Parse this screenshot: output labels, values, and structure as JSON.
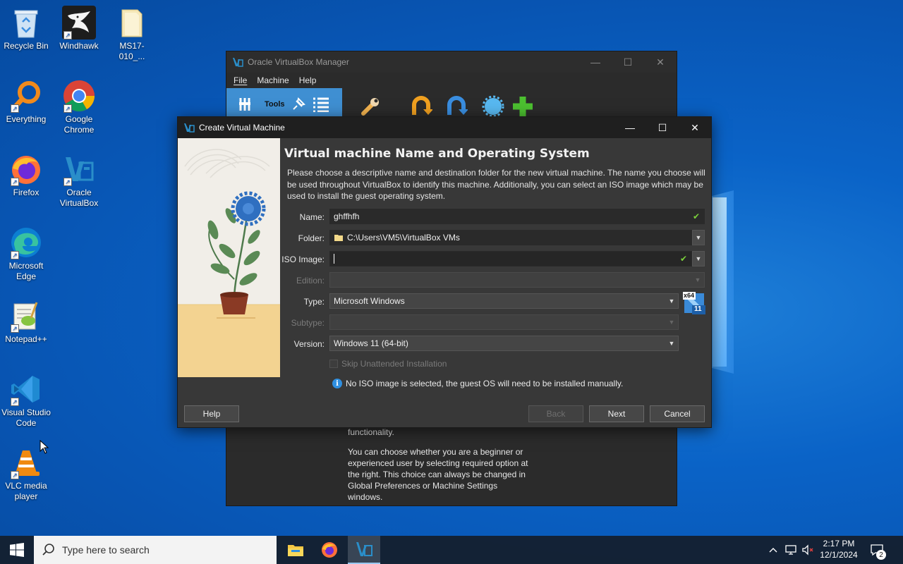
{
  "desktop": {
    "icons": [
      {
        "label": "Recycle Bin",
        "icon": "recycle-bin-icon"
      },
      {
        "label": "Windhawk",
        "icon": "windhawk-icon"
      },
      {
        "label": "MS17-010_...",
        "icon": "folder-icon"
      },
      {
        "label": "Everything",
        "icon": "everything-icon"
      },
      {
        "label": "Google Chrome",
        "icon": "chrome-icon"
      },
      {
        "label": "Firefox",
        "icon": "firefox-icon"
      },
      {
        "label": "Oracle VirtualBox",
        "icon": "virtualbox-icon"
      },
      {
        "label": "Microsoft Edge",
        "icon": "edge-icon"
      },
      {
        "label": "Notepad++",
        "icon": "notepadpp-icon"
      },
      {
        "label": "Visual Studio Code",
        "icon": "vscode-icon"
      },
      {
        "label": "VLC media player",
        "icon": "vlc-icon"
      }
    ]
  },
  "manager": {
    "title": "Oracle VirtualBox Manager",
    "menu": [
      "File",
      "Machine",
      "Help"
    ],
    "tools_label": "Tools",
    "welcome_text_1": "functionality.",
    "welcome_text_2": "You can choose whether you are a beginner or experienced user by selecting required option at the right. This choice can always be changed in Global Preferences or Machine Settings windows."
  },
  "dialog": {
    "title": "Create Virtual Machine",
    "heading": "Virtual machine Name and Operating System",
    "description": "Please choose a descriptive name and destination folder for the new virtual machine. The name you choose will be used throughout VirtualBox to identify this machine. Additionally, you can select an ISO image which may be used to install the guest operating system.",
    "labels": {
      "name": "Name:",
      "folder": "Folder:",
      "iso": "ISO Image:",
      "edition": "Edition:",
      "type": "Type:",
      "subtype": "Subtype:",
      "version": "Version:"
    },
    "values": {
      "name": "ghffhfh",
      "folder": "C:\\Users\\VM5\\VirtualBox VMs",
      "iso": "",
      "edition": "",
      "type": "Microsoft Windows",
      "subtype": "",
      "version": "Windows 11 (64-bit)"
    },
    "os_badge_top": "x64",
    "os_badge_bottom": "11",
    "skip_unattended": "Skip Unattended Installation",
    "info_message": "No ISO image is selected, the guest OS will need to be installed manually.",
    "buttons": {
      "help": "Help",
      "back": "Back",
      "next": "Next",
      "cancel": "Cancel"
    }
  },
  "taskbar": {
    "search_placeholder": "Type here to search",
    "time": "2:17 PM",
    "date": "12/1/2024",
    "notification_count": "2"
  },
  "colors": {
    "desktop_blue": "#0a63c7",
    "dialog_bg": "#383838",
    "tools_accent": "#3f8fd2",
    "check_green": "#7bd13b"
  }
}
